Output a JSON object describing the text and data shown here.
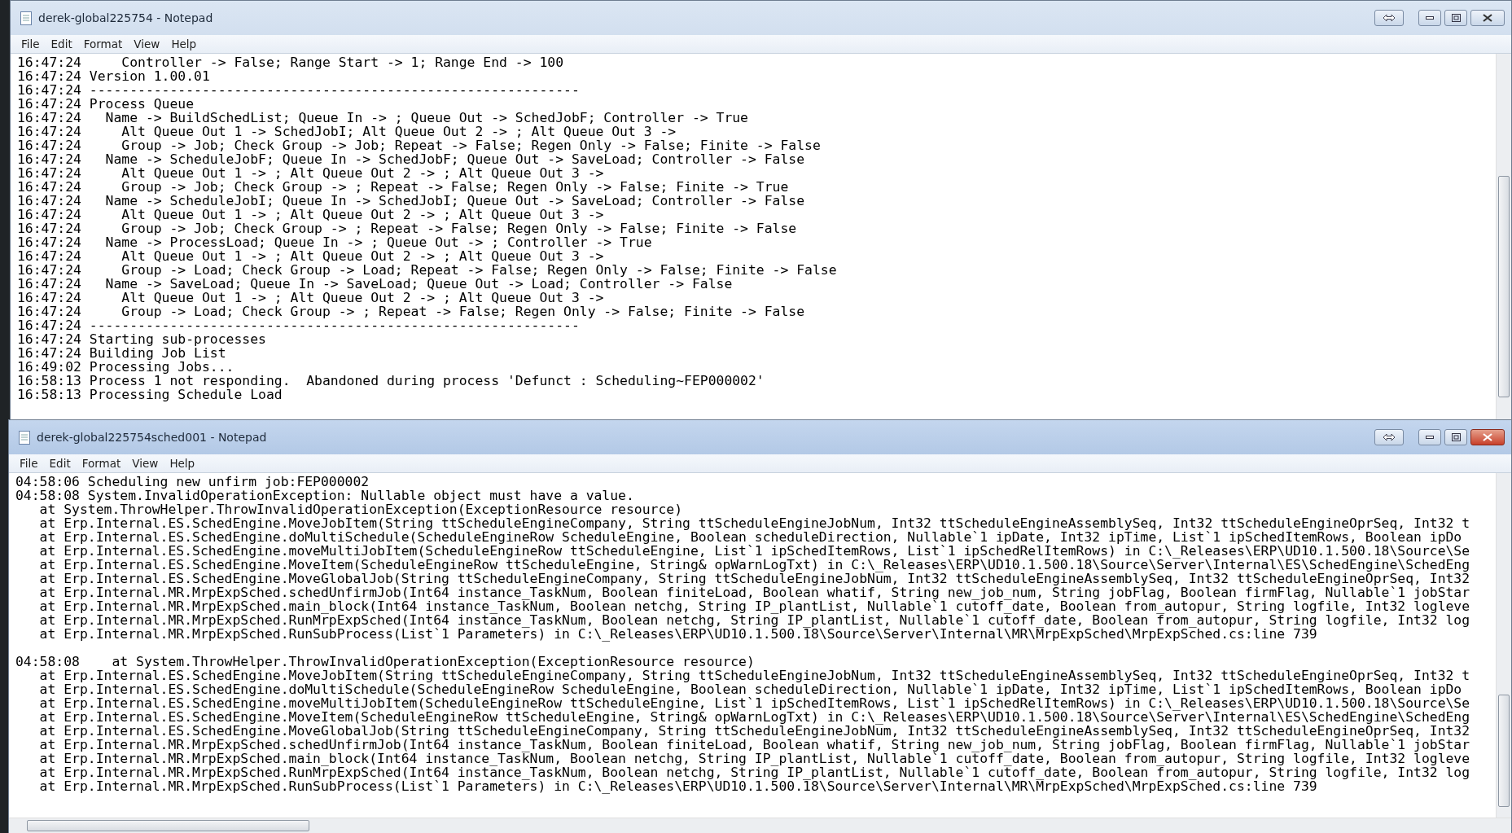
{
  "windows": [
    {
      "title": "derek-global225754 - Notepad",
      "active": false,
      "menu": [
        "File",
        "Edit",
        "Format",
        "View",
        "Help"
      ],
      "blocks": [
        [
          "16:47:24     Controller -> False; Range Start -> 1; Range End -> 100",
          "16:47:24 Version 1.00.01",
          "16:47:24 -------------------------------------------------------------",
          "16:47:24 Process Queue",
          "16:47:24   Name -> BuildSchedList; Queue In -> ; Queue Out -> SchedJobF; Controller -> True",
          "16:47:24     Alt Queue Out 1 -> SchedJobI; Alt Queue Out 2 -> ; Alt Queue Out 3 ->",
          "16:47:24     Group -> Job; Check Group -> Job; Repeat -> False; Regen Only -> False; Finite -> False",
          "16:47:24   Name -> ScheduleJobF; Queue In -> SchedJobF; Queue Out -> SaveLoad; Controller -> False",
          "16:47:24     Alt Queue Out 1 -> ; Alt Queue Out 2 -> ; Alt Queue Out 3 ->",
          "16:47:24     Group -> Job; Check Group -> ; Repeat -> False; Regen Only -> False; Finite -> True",
          "16:47:24   Name -> ScheduleJobI; Queue In -> SchedJobI; Queue Out -> SaveLoad; Controller -> False",
          "16:47:24     Alt Queue Out 1 -> ; Alt Queue Out 2 -> ; Alt Queue Out 3 ->",
          "16:47:24     Group -> Job; Check Group -> ; Repeat -> False; Regen Only -> False; Finite -> False",
          "16:47:24   Name -> ProcessLoad; Queue In -> ; Queue Out -> ; Controller -> True",
          "16:47:24     Alt Queue Out 1 -> ; Alt Queue Out 2 -> ; Alt Queue Out 3 ->",
          "16:47:24     Group -> Load; Check Group -> Load; Repeat -> False; Regen Only -> False; Finite -> False",
          "16:47:24   Name -> SaveLoad; Queue In -> SaveLoad; Queue Out -> Load; Controller -> False",
          "16:47:24     Alt Queue Out 1 -> ; Alt Queue Out 2 -> ; Alt Queue Out 3 ->",
          "16:47:24     Group -> Load; Check Group -> ; Repeat -> False; Regen Only -> False; Finite -> False",
          "16:47:24 -------------------------------------------------------------",
          "16:47:24 Starting sub-processes",
          "16:47:24 Building Job List",
          "16:49:02 Processing Jobs...",
          "16:58:13 Process 1 not responding.  Abandoned during process 'Defunct : Scheduling~FEP000002'",
          "16:58:13 Processing Schedule Load"
        ]
      ]
    },
    {
      "title": "derek-global225754sched001 - Notepad",
      "active": true,
      "menu": [
        "File",
        "Edit",
        "Format",
        "View",
        "Help"
      ],
      "blocks": [
        [
          "04:58:06 Scheduling new unfirm job:FEP000002",
          "04:58:08 System.InvalidOperationException: Nullable object must have a value.",
          "   at System.ThrowHelper.ThrowInvalidOperationException(ExceptionResource resource)",
          "   at Erp.Internal.ES.SchedEngine.MoveJobItem(String ttScheduleEngineCompany, String ttScheduleEngineJobNum, Int32 ttScheduleEngineAssemblySeq, Int32 ttScheduleEngineOprSeq, Int32 t",
          "   at Erp.Internal.ES.SchedEngine.doMultiSchedule(ScheduleEngineRow ScheduleEngine, Boolean scheduleDirection, Nullable`1 ipDate, Int32 ipTime, List`1 ipSchedItemRows, Boolean ipDo",
          "   at Erp.Internal.ES.SchedEngine.moveMultiJobItem(ScheduleEngineRow ttScheduleEngine, List`1 ipSchedItemRows, List`1 ipSchedRelItemRows) in C:\\_Releases\\ERP\\UD10.1.500.18\\Source\\Se",
          "   at Erp.Internal.ES.SchedEngine.MoveItem(ScheduleEngineRow ttScheduleEngine, String& opWarnLogTxt) in C:\\_Releases\\ERP\\UD10.1.500.18\\Source\\Server\\Internal\\ES\\SchedEngine\\SchedEng",
          "   at Erp.Internal.ES.SchedEngine.MoveGlobalJob(String ttScheduleEngineCompany, String ttScheduleEngineJobNum, Int32 ttScheduleEngineAssemblySeq, Int32 ttScheduleEngineOprSeq, Int32",
          "   at Erp.Internal.MR.MrpExpSched.schedUnfirmJob(Int64 instance_TaskNum, Boolean finiteLoad, Boolean whatif, String new_job_num, String jobFlag, Boolean firmFlag, Nullable`1 jobStar",
          "   at Erp.Internal.MR.MrpExpSched.main_block(Int64 instance_TaskNum, Boolean netchg, String IP_plantList, Nullable`1 cutoff_date, Boolean from_autopur, String logfile, Int32 logleve",
          "   at Erp.Internal.MR.MrpExpSched.RunMrpExpSched(Int64 instance_TaskNum, Boolean netchg, String IP_plantList, Nullable`1 cutoff_date, Boolean from_autopur, String logfile, Int32 log",
          "   at Erp.Internal.MR.MrpExpSched.RunSubProcess(List`1 Parameters) in C:\\_Releases\\ERP\\UD10.1.500.18\\Source\\Server\\Internal\\MR\\MrpExpSched\\MrpExpSched.cs:line 739"
        ],
        [
          "04:58:08    at System.ThrowHelper.ThrowInvalidOperationException(ExceptionResource resource)",
          "   at Erp.Internal.ES.SchedEngine.MoveJobItem(String ttScheduleEngineCompany, String ttScheduleEngineJobNum, Int32 ttScheduleEngineAssemblySeq, Int32 ttScheduleEngineOprSeq, Int32 t",
          "   at Erp.Internal.ES.SchedEngine.doMultiSchedule(ScheduleEngineRow ScheduleEngine, Boolean scheduleDirection, Nullable`1 ipDate, Int32 ipTime, List`1 ipSchedItemRows, Boolean ipDo",
          "   at Erp.Internal.ES.SchedEngine.moveMultiJobItem(ScheduleEngineRow ttScheduleEngine, List`1 ipSchedItemRows, List`1 ipSchedRelItemRows) in C:\\_Releases\\ERP\\UD10.1.500.18\\Source\\Se",
          "   at Erp.Internal.ES.SchedEngine.MoveItem(ScheduleEngineRow ttScheduleEngine, String& opWarnLogTxt) in C:\\_Releases\\ERP\\UD10.1.500.18\\Source\\Server\\Internal\\ES\\SchedEngine\\SchedEng",
          "   at Erp.Internal.ES.SchedEngine.MoveGlobalJob(String ttScheduleEngineCompany, String ttScheduleEngineJobNum, Int32 ttScheduleEngineAssemblySeq, Int32 ttScheduleEngineOprSeq, Int32",
          "   at Erp.Internal.MR.MrpExpSched.schedUnfirmJob(Int64 instance_TaskNum, Boolean finiteLoad, Boolean whatif, String new_job_num, String jobFlag, Boolean firmFlag, Nullable`1 jobStar",
          "   at Erp.Internal.MR.MrpExpSched.main_block(Int64 instance_TaskNum, Boolean netchg, String IP_plantList, Nullable`1 cutoff_date, Boolean from_autopur, String logfile, Int32 logleve",
          "   at Erp.Internal.MR.MrpExpSched.RunMrpExpSched(Int64 instance_TaskNum, Boolean netchg, String IP_plantList, Nullable`1 cutoff_date, Boolean from_autopur, String logfile, Int32 log",
          "   at Erp.Internal.MR.MrpExpSched.RunSubProcess(List`1 Parameters) in C:\\_Releases\\ERP\\UD10.1.500.18\\Source\\Server\\Internal\\MR\\MrpExpSched\\MrpExpSched.cs:line 739"
        ]
      ]
    }
  ]
}
